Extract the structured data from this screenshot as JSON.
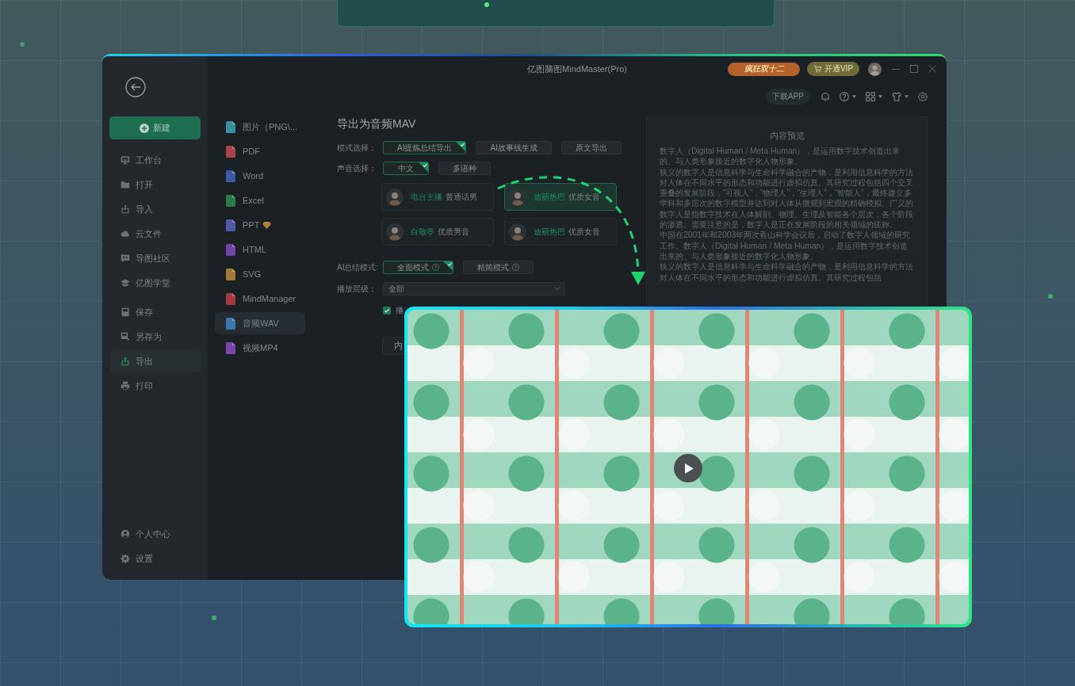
{
  "window": {
    "title": "亿图脑图MindMaster(Pro)",
    "promo_button": "疯狂双十二",
    "vip_button": "开通VIP"
  },
  "toolbar": {
    "download_button": "下载APP"
  },
  "sidebar": {
    "new_button": "新建",
    "groups": [
      {
        "items": [
          {
            "label": "工作台",
            "selected": false
          },
          {
            "label": "打开",
            "selected": false
          },
          {
            "label": "导入",
            "selected": false
          },
          {
            "label": "云文件",
            "selected": false
          },
          {
            "label": "导图社区",
            "selected": false
          },
          {
            "label": "亿图学堂",
            "selected": false
          }
        ]
      },
      {
        "items": [
          {
            "label": "保存",
            "selected": false
          },
          {
            "label": "另存为",
            "selected": false
          },
          {
            "label": "导出",
            "selected": true
          },
          {
            "label": "打印",
            "selected": false
          }
        ]
      }
    ],
    "bottom_items": [
      "个人中心",
      "设置"
    ]
  },
  "export_formats": [
    {
      "label": "图片（PNG\\...",
      "color": "#3d8da0",
      "premium": false,
      "selected": false
    },
    {
      "label": "PDF",
      "color": "#a8434a",
      "premium": false,
      "selected": false
    },
    {
      "label": "Word",
      "color": "#3a5ca6",
      "premium": false,
      "selected": false
    },
    {
      "label": "Excel",
      "color": "#2b7a4b",
      "premium": false,
      "selected": false
    },
    {
      "label": "PPT",
      "color": "#5458a8",
      "premium": true,
      "selected": false
    },
    {
      "label": "HTML",
      "color": "#7443a8",
      "premium": false,
      "selected": false
    },
    {
      "label": "SVG",
      "color": "#a07a36",
      "premium": false,
      "selected": false
    },
    {
      "label": "MindManager",
      "color": "#a23a3e",
      "premium": false,
      "selected": false
    },
    {
      "label": "音频WAV",
      "color": "#3b78ad",
      "premium": false,
      "selected": true
    },
    {
      "label": "视频MP4",
      "color": "#7b45ad",
      "premium": false,
      "selected": false
    }
  ],
  "export_form": {
    "title": "导出为音频MAV",
    "mode": {
      "label": "模式选择：",
      "options": [
        {
          "label": "AI提炼总结导出",
          "selected": true
        },
        {
          "label": "AI故事线生成",
          "selected": false
        },
        {
          "label": "原文导出",
          "selected": false
        }
      ]
    },
    "voice_language": {
      "label": "声音选择：",
      "options": [
        {
          "label": "中文",
          "selected": true
        },
        {
          "label": "多语种",
          "selected": false
        }
      ]
    },
    "voices": [
      {
        "name": "电台主播",
        "quality": "普通话男",
        "selected": false
      },
      {
        "name": "迪丽热巴",
        "quality": "优质女音",
        "selected": true
      },
      {
        "name": "白敬亭",
        "quality": "优质男音",
        "selected": false
      },
      {
        "name": "迪丽热巴",
        "quality": "优质女音",
        "selected": false
      }
    ],
    "summary_mode": {
      "label": "AI总结模式:",
      "options": [
        {
          "label": "全面模式",
          "selected": true
        },
        {
          "label": "精简模式",
          "selected": false
        }
      ]
    },
    "play_level": {
      "label": "播放层级：",
      "value": "全部"
    },
    "checkbox": {
      "label": "播",
      "checked": true
    },
    "button": "内"
  },
  "preview": {
    "title": "内容预览",
    "paragraphs": [
      "数字人（Digital Human / Meta Human），是运用数字技术创造出来的、与人类形象接近的数字化人物形象。",
      "狭义的数字人是信息科学与生命科学融合的产物，是利用信息科学的方法对人体在不同水平的形态和功能进行虚拟仿真。其研究过程包括四个交叉重叠的发展阶段，“可视人”，“物理人”，“生理人”，“智能人”，最终建立多学科和多层次的数字模型并达到对人体从微观到宏观的精确模拟。广义的数字人是指数字技术在人体解剖、物理、生理及智能各个层次，各个阶段的渗透。需要注意的是，数字人是正在发展阶段的相关领域的统称。",
      "中国在2001年和2003年两次香山科学会议后，启动了数字人领域的研究工作。数字人（Digital Human / Meta Human），是运用数字技术创造出来的、与人类形象接近的数字化人物形象。",
      "狭义的数字人是信息科学与生命科学融合的产物，是利用信息科学的方法对人体在不同水平的形态和功能进行虚拟仿真。其研究过程包括"
    ]
  }
}
